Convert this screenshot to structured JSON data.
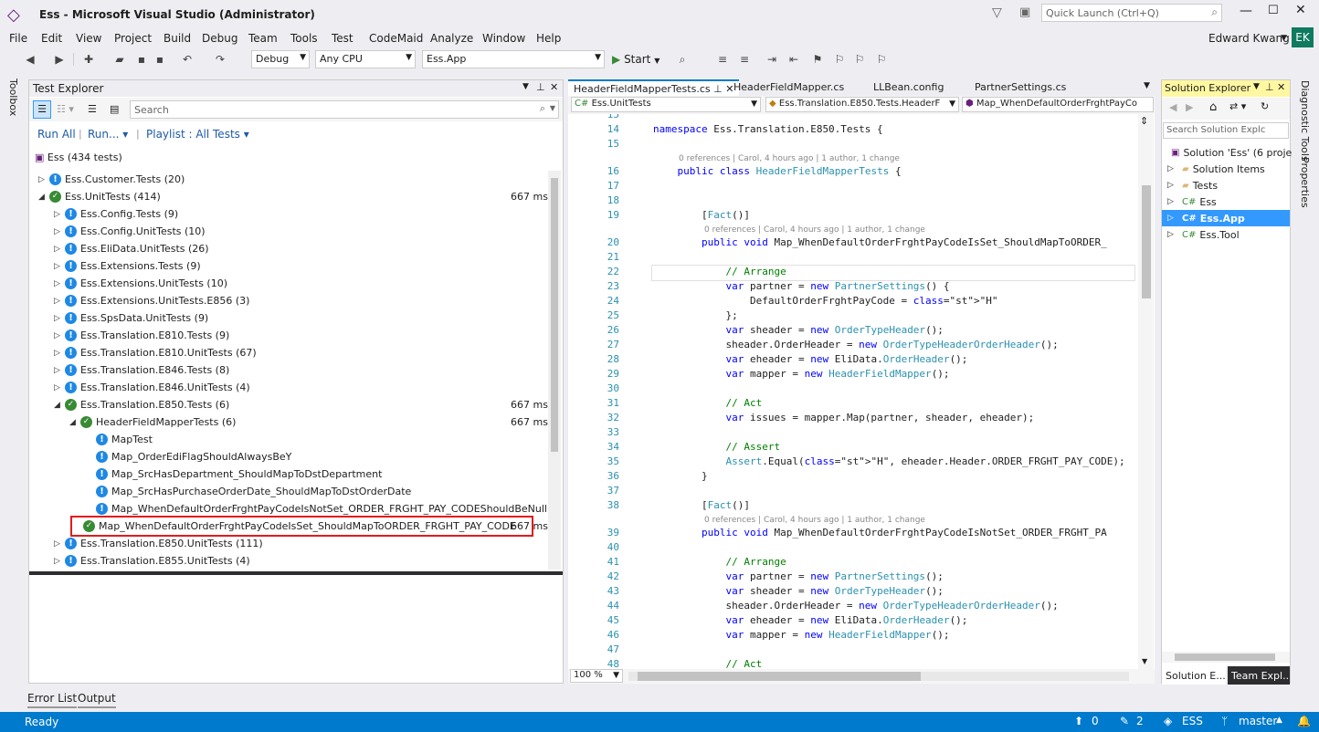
{
  "window": {
    "title": "Ess - Microsoft Visual Studio  (Administrator)",
    "quick_launch_placeholder": "Quick Launch (Ctrl+Q)",
    "user": "Edward Kwang",
    "avatar": "EK"
  },
  "menu": [
    "File",
    "Edit",
    "View",
    "Project",
    "Build",
    "Debug",
    "Team",
    "Tools",
    "Test",
    "CodeMaid",
    "Analyze",
    "Window",
    "Help"
  ],
  "toolbar": {
    "config": "Debug",
    "platform": "Any CPU",
    "startup": "Ess.App",
    "start_label": "Start"
  },
  "left_strip": {
    "toolbox": "Toolbox"
  },
  "right_strip": {
    "diagnostic": "Diagnostic Tools",
    "properties": "Properties"
  },
  "test_explorer": {
    "title": "Test Explorer",
    "search_placeholder": "Search",
    "run_all": "Run All",
    "run": "Run...",
    "playlist": "Playlist : All Tests",
    "root": "Ess (434 tests)",
    "rows": [
      {
        "label": "Ess.Customer.Tests (20)",
        "status": "warn",
        "level": 0,
        "expanded": false,
        "dur": ""
      },
      {
        "label": "Ess.UnitTests (414)",
        "status": "ok",
        "level": 0,
        "expanded": true,
        "dur": "667 ms"
      },
      {
        "label": "Ess.Config.Tests (9)",
        "status": "warn",
        "level": 1,
        "expanded": false,
        "dur": ""
      },
      {
        "label": "Ess.Config.UnitTests (10)",
        "status": "warn",
        "level": 1,
        "expanded": false,
        "dur": ""
      },
      {
        "label": "Ess.EliData.UnitTests (26)",
        "status": "warn",
        "level": 1,
        "expanded": false,
        "dur": ""
      },
      {
        "label": "Ess.Extensions.Tests (9)",
        "status": "warn",
        "level": 1,
        "expanded": false,
        "dur": ""
      },
      {
        "label": "Ess.Extensions.UnitTests (10)",
        "status": "warn",
        "level": 1,
        "expanded": false,
        "dur": ""
      },
      {
        "label": "Ess.Extensions.UnitTests.E856 (3)",
        "status": "warn",
        "level": 1,
        "expanded": false,
        "dur": ""
      },
      {
        "label": "Ess.SpsData.UnitTests (9)",
        "status": "warn",
        "level": 1,
        "expanded": false,
        "dur": ""
      },
      {
        "label": "Ess.Translation.E810.Tests (9)",
        "status": "warn",
        "level": 1,
        "expanded": false,
        "dur": ""
      },
      {
        "label": "Ess.Translation.E810.UnitTests (67)",
        "status": "warn",
        "level": 1,
        "expanded": false,
        "dur": ""
      },
      {
        "label": "Ess.Translation.E846.Tests (8)",
        "status": "warn",
        "level": 1,
        "expanded": false,
        "dur": ""
      },
      {
        "label": "Ess.Translation.E846.UnitTests (4)",
        "status": "warn",
        "level": 1,
        "expanded": false,
        "dur": ""
      },
      {
        "label": "Ess.Translation.E850.Tests (6)",
        "status": "ok",
        "level": 1,
        "expanded": true,
        "dur": "667 ms"
      },
      {
        "label": "HeaderFieldMapperTests (6)",
        "status": "ok",
        "level": 2,
        "expanded": true,
        "dur": "667 ms"
      },
      {
        "label": "MapTest",
        "status": "warn",
        "level": 3,
        "expanded": null,
        "dur": ""
      },
      {
        "label": "Map_OrderEdiFlagShouldAlwaysBeY",
        "status": "warn",
        "level": 3,
        "expanded": null,
        "dur": ""
      },
      {
        "label": "Map_SrcHasDepartment_ShouldMapToDstDepartment",
        "status": "warn",
        "level": 3,
        "expanded": null,
        "dur": ""
      },
      {
        "label": "Map_SrcHasPurchaseOrderDate_ShouldMapToDstOrderDate",
        "status": "warn",
        "level": 3,
        "expanded": null,
        "dur": ""
      },
      {
        "label": "Map_WhenDefaultOrderFrghtPayCodeIsNotSet_ORDER_FRGHT_PAY_CODEShouldBeNull",
        "status": "warn",
        "level": 3,
        "expanded": null,
        "dur": ""
      },
      {
        "label": "Map_WhenDefaultOrderFrghtPayCodeIsSet_ShouldMapToORDER_FRGHT_PAY_CODE",
        "status": "ok",
        "level": 3,
        "expanded": null,
        "dur": "667 ms",
        "selected": true
      },
      {
        "label": "Ess.Translation.E850.UnitTests (111)",
        "status": "warn",
        "level": 1,
        "expanded": false,
        "dur": ""
      },
      {
        "label": "Ess.Translation.E855.UnitTests (4)",
        "status": "warn",
        "level": 1,
        "expanded": false,
        "dur": ""
      }
    ]
  },
  "editor": {
    "tabs": [
      "HeaderFieldMapperTests.cs",
      "HeaderFieldMapper.cs",
      "LLBean.config",
      "PartnerSettings.cs"
    ],
    "nav": [
      "Ess.UnitTests",
      "Ess.Translation.E850.Tests.HeaderF",
      "Map_WhenDefaultOrderFrghtPayCo"
    ],
    "zoom": "100 %",
    "lines": [
      {
        "n": "15",
        "t": ""
      },
      {
        "n": "14",
        "t": "namespace Ess.Translation.E850.Tests {"
      },
      {
        "n": "15",
        "t": ""
      },
      {
        "n": "",
        "lens": "0 references | Carol, 4 hours ago | 1 author, 1 change",
        "ind": 4
      },
      {
        "n": "16",
        "t": "    public class HeaderFieldMapperTests {"
      },
      {
        "n": "17",
        "t": ""
      },
      {
        "n": "18",
        "t": ""
      },
      {
        "n": "19",
        "t": "        [Fact()]"
      },
      {
        "n": "",
        "lens": "0 references | Carol, 4 hours ago | 1 author, 1 change",
        "ind": 8
      },
      {
        "n": "20",
        "t": "        public void Map_WhenDefaultOrderFrghtPayCodeIsSet_ShouldMapToORDER_"
      },
      {
        "n": "21",
        "t": ""
      },
      {
        "n": "22",
        "t": "            // Arrange"
      },
      {
        "n": "23",
        "t": "            var partner = new PartnerSettings() {"
      },
      {
        "n": "24",
        "t": "                DefaultOrderFrghtPayCode = \"H\""
      },
      {
        "n": "25",
        "t": "            };"
      },
      {
        "n": "26",
        "t": "            var sheader = new OrderTypeHeader();"
      },
      {
        "n": "27",
        "t": "            sheader.OrderHeader = new OrderTypeHeaderOrderHeader();"
      },
      {
        "n": "28",
        "t": "            var eheader = new EliData.OrderHeader();"
      },
      {
        "n": "29",
        "t": "            var mapper = new HeaderFieldMapper();"
      },
      {
        "n": "30",
        "t": ""
      },
      {
        "n": "31",
        "t": "            // Act"
      },
      {
        "n": "32",
        "t": "            var issues = mapper.Map(partner, sheader, eheader);"
      },
      {
        "n": "33",
        "t": ""
      },
      {
        "n": "34",
        "t": "            // Assert"
      },
      {
        "n": "35",
        "t": "            Assert.Equal(\"H\", eheader.Header.ORDER_FRGHT_PAY_CODE);"
      },
      {
        "n": "36",
        "t": "        }"
      },
      {
        "n": "37",
        "t": ""
      },
      {
        "n": "38",
        "t": "        [Fact()]"
      },
      {
        "n": "",
        "lens": "0 references | Carol, 4 hours ago | 1 author, 1 change",
        "ind": 8
      },
      {
        "n": "39",
        "t": "        public void Map_WhenDefaultOrderFrghtPayCodeIsNotSet_ORDER_FRGHT_PA"
      },
      {
        "n": "40",
        "t": ""
      },
      {
        "n": "41",
        "t": "            // Arrange"
      },
      {
        "n": "42",
        "t": "            var partner = new PartnerSettings();"
      },
      {
        "n": "43",
        "t": "            var sheader = new OrderTypeHeader();"
      },
      {
        "n": "44",
        "t": "            sheader.OrderHeader = new OrderTypeHeaderOrderHeader();"
      },
      {
        "n": "45",
        "t": "            var eheader = new EliData.OrderHeader();"
      },
      {
        "n": "46",
        "t": "            var mapper = new HeaderFieldMapper();"
      },
      {
        "n": "47",
        "t": ""
      },
      {
        "n": "48",
        "t": "            // Act"
      }
    ]
  },
  "solution_explorer": {
    "title": "Solution Explorer",
    "search_placeholder": "Search Solution Explc",
    "items": [
      {
        "label": "Solution 'Ess' (6 projec",
        "kind": "solution"
      },
      {
        "label": "Solution Items",
        "kind": "folder"
      },
      {
        "label": "Tests",
        "kind": "folder"
      },
      {
        "label": "Ess",
        "kind": "project"
      },
      {
        "label": "Ess.App",
        "kind": "project",
        "selected": true
      },
      {
        "label": "Ess.Tool",
        "kind": "project"
      }
    ],
    "bottom_tabs": [
      "Solution E...",
      "Team Expl..."
    ]
  },
  "bottom_tabs": [
    "Error List",
    "Output"
  ],
  "status": {
    "ready": "Ready",
    "up": "0",
    "edits": "2",
    "repo": "ESS",
    "branch": "master"
  }
}
